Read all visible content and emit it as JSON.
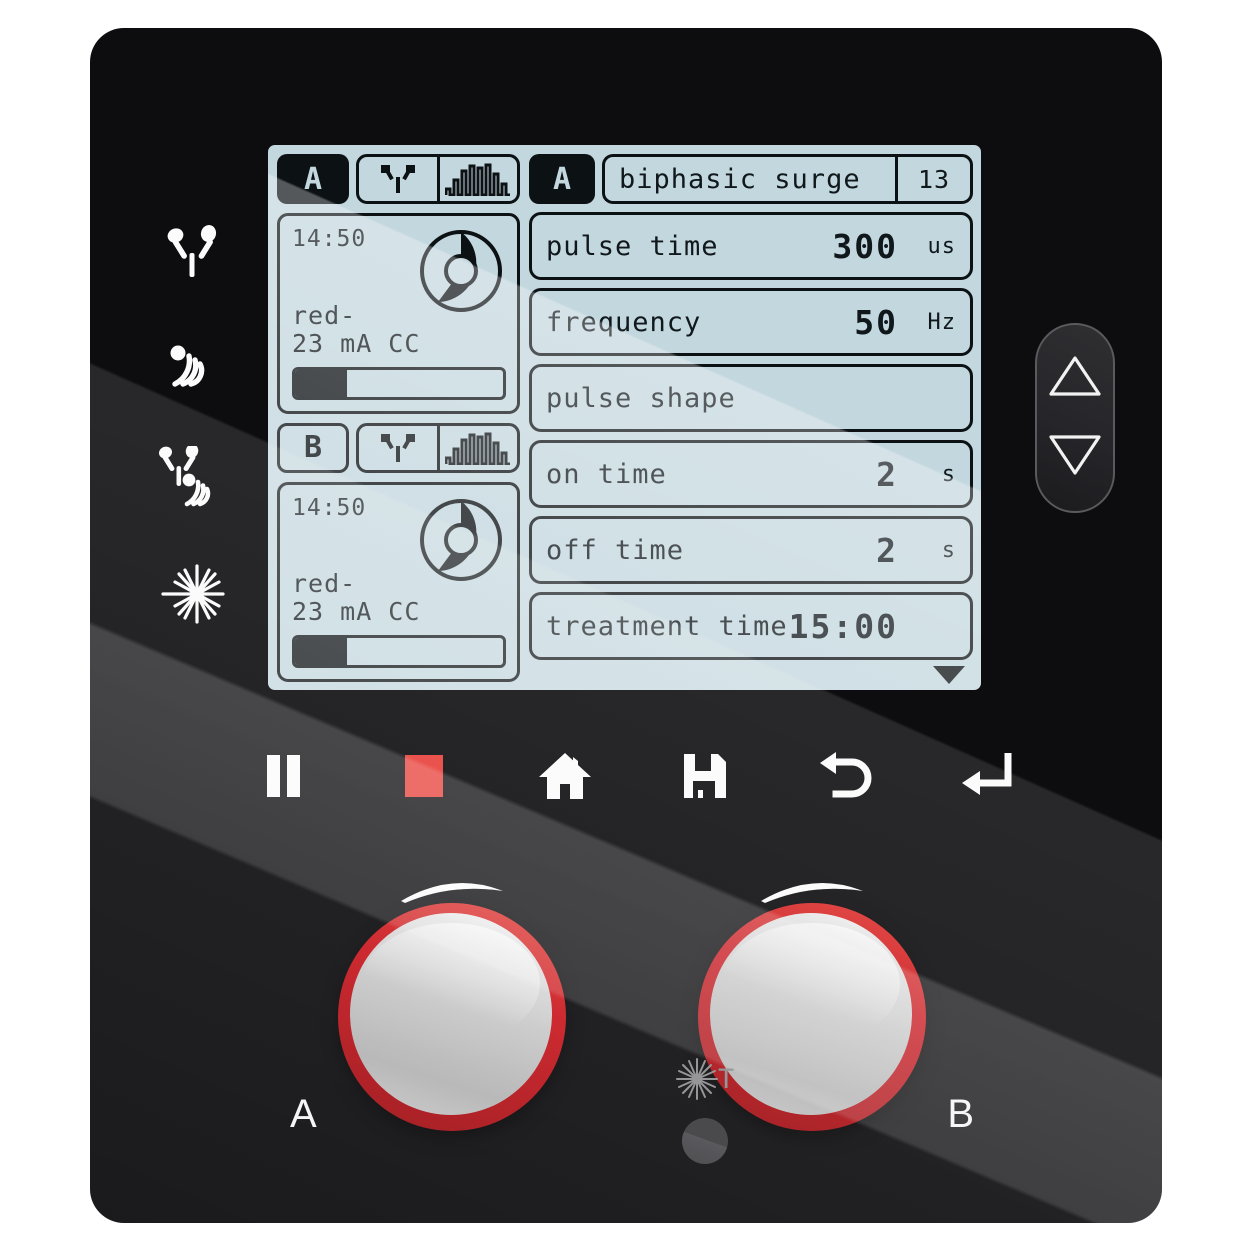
{
  "device": {
    "name": "electrotherapy-ultrasound-combination-unit",
    "body_color": "#0d0d10",
    "lcd_color": "#c3d7de",
    "lcd_ink": "#0c1114",
    "accent_red": "#c8171e",
    "stop_red": "#e8413a"
  },
  "sidebar": {
    "items": [
      {
        "label": "electrotherapy",
        "icon": "electrode-y-icon"
      },
      {
        "label": "ultrasound",
        "icon": "ultrasound-waves-icon"
      },
      {
        "label": "combination therapy",
        "icon": "combination-therapy-icon"
      },
      {
        "label": "laser",
        "icon": "laser-starburst-icon"
      }
    ]
  },
  "lcd": {
    "channels": [
      {
        "id": "A",
        "active": true,
        "mode_icon": "electrode-y-icon",
        "waveform_icon": "burst-surge-waveform-icon",
        "time_remaining": "14:50",
        "dose_line1": "red-",
        "dose_line2": "23 mA CC",
        "intensity_percent": 25,
        "donut_percent": 55
      },
      {
        "id": "B",
        "active": false,
        "mode_icon": "electrode-y-icon",
        "waveform_icon": "burst-surge-waveform-icon",
        "time_remaining": "14:50",
        "dose_line1": "red-",
        "dose_line2": "23 mA CC",
        "intensity_percent": 25,
        "donut_percent": 55
      }
    ],
    "program": {
      "channel_badge": "A",
      "name": "biphasic surge",
      "number": "13"
    },
    "parameters": [
      {
        "label": "pulse time",
        "value": "300",
        "unit": "us"
      },
      {
        "label": "frequency",
        "value": "50",
        "unit": "Hz"
      },
      {
        "label": "pulse shape",
        "value": "",
        "unit": ""
      },
      {
        "label": "on time",
        "value": "2",
        "unit": "s"
      },
      {
        "label": "off time",
        "value": "2",
        "unit": "s"
      },
      {
        "label": "treatment time",
        "value": "15:00",
        "unit": ""
      }
    ],
    "scroll_indicator": "scroll-down-arrow-icon"
  },
  "rocker": {
    "up_label": "increase",
    "down_label": "decrease"
  },
  "transport": {
    "buttons": [
      {
        "name": "pause-button",
        "icon": "pause-icon"
      },
      {
        "name": "stop-button",
        "icon": "stop-square-icon"
      },
      {
        "name": "home-button",
        "icon": "home-icon"
      },
      {
        "name": "save-button",
        "icon": "floppy-disk-icon"
      },
      {
        "name": "back-button",
        "icon": "undo-arrow-icon"
      },
      {
        "name": "enter-button",
        "icon": "enter-return-icon"
      }
    ]
  },
  "knobs": [
    {
      "id": "A",
      "label": "A"
    },
    {
      "id": "B",
      "label": "B"
    }
  ],
  "laser_indicator": {
    "icon": "laser-starburst-icon",
    "label": "T"
  }
}
